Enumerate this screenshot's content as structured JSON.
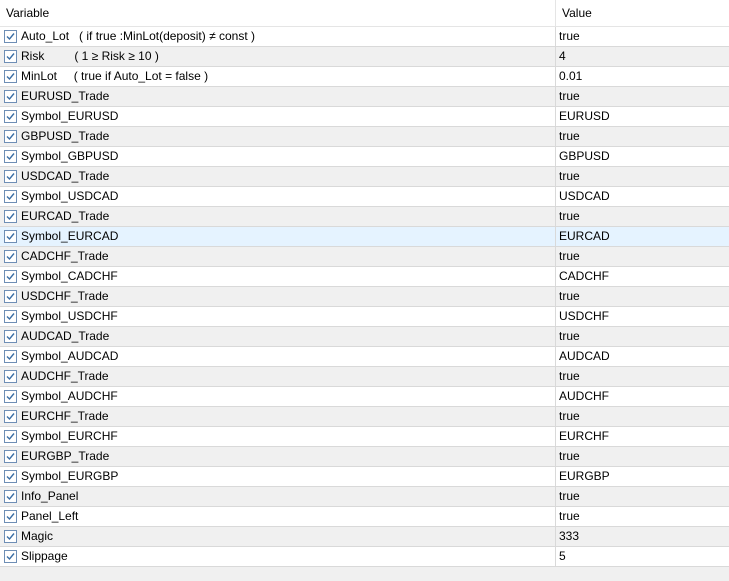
{
  "header": {
    "variable_label": "Variable",
    "value_label": "Value"
  },
  "rows": [
    {
      "name": "Auto_Lot   ( if true :MinLot(deposit) ≠ const )",
      "value": "true",
      "checked": true
    },
    {
      "name": "Risk         ( 1 ≥ Risk ≥ 10 )",
      "value": "4",
      "checked": true
    },
    {
      "name": "MinLot     ( true if Auto_Lot = false )",
      "value": "0.01",
      "checked": true
    },
    {
      "name": "EURUSD_Trade",
      "value": "true",
      "checked": true
    },
    {
      "name": "Symbol_EURUSD",
      "value": "EURUSD",
      "checked": true
    },
    {
      "name": "GBPUSD_Trade",
      "value": "true",
      "checked": true
    },
    {
      "name": "Symbol_GBPUSD",
      "value": "GBPUSD",
      "checked": true
    },
    {
      "name": "USDCAD_Trade",
      "value": "true",
      "checked": true
    },
    {
      "name": "Symbol_USDCAD",
      "value": "USDCAD",
      "checked": true
    },
    {
      "name": "EURCAD_Trade",
      "value": "true",
      "checked": true
    },
    {
      "name": "Symbol_EURCAD",
      "value": "EURCAD",
      "checked": true,
      "selected": true
    },
    {
      "name": "CADCHF_Trade",
      "value": "true",
      "checked": true
    },
    {
      "name": "Symbol_CADCHF",
      "value": "CADCHF",
      "checked": true
    },
    {
      "name": "USDCHF_Trade",
      "value": "true",
      "checked": true
    },
    {
      "name": "Symbol_USDCHF",
      "value": "USDCHF",
      "checked": true
    },
    {
      "name": "AUDCAD_Trade",
      "value": "true",
      "checked": true
    },
    {
      "name": "Symbol_AUDCAD",
      "value": "AUDCAD",
      "checked": true
    },
    {
      "name": "AUDCHF_Trade",
      "value": "true",
      "checked": true
    },
    {
      "name": "Symbol_AUDCHF",
      "value": "AUDCHF",
      "checked": true
    },
    {
      "name": "EURCHF_Trade",
      "value": "true",
      "checked": true
    },
    {
      "name": "Symbol_EURCHF",
      "value": "EURCHF",
      "checked": true
    },
    {
      "name": "EURGBP_Trade",
      "value": "true",
      "checked": true
    },
    {
      "name": "Symbol_EURGBP",
      "value": "EURGBP",
      "checked": true
    },
    {
      "name": "Info_Panel",
      "value": "true",
      "checked": true
    },
    {
      "name": "Panel_Left",
      "value": "true",
      "checked": true
    },
    {
      "name": "Magic",
      "value": "333",
      "checked": true
    },
    {
      "name": "Slippage",
      "value": "5",
      "checked": true
    }
  ],
  "colors": {
    "row_bg": "#ffffff",
    "row_alt_bg": "#f0f0f0",
    "row_selected_bg": "#e5f3ff",
    "checkbox_border": "#6e8eb5",
    "checkmark": "#3a6ea5"
  }
}
